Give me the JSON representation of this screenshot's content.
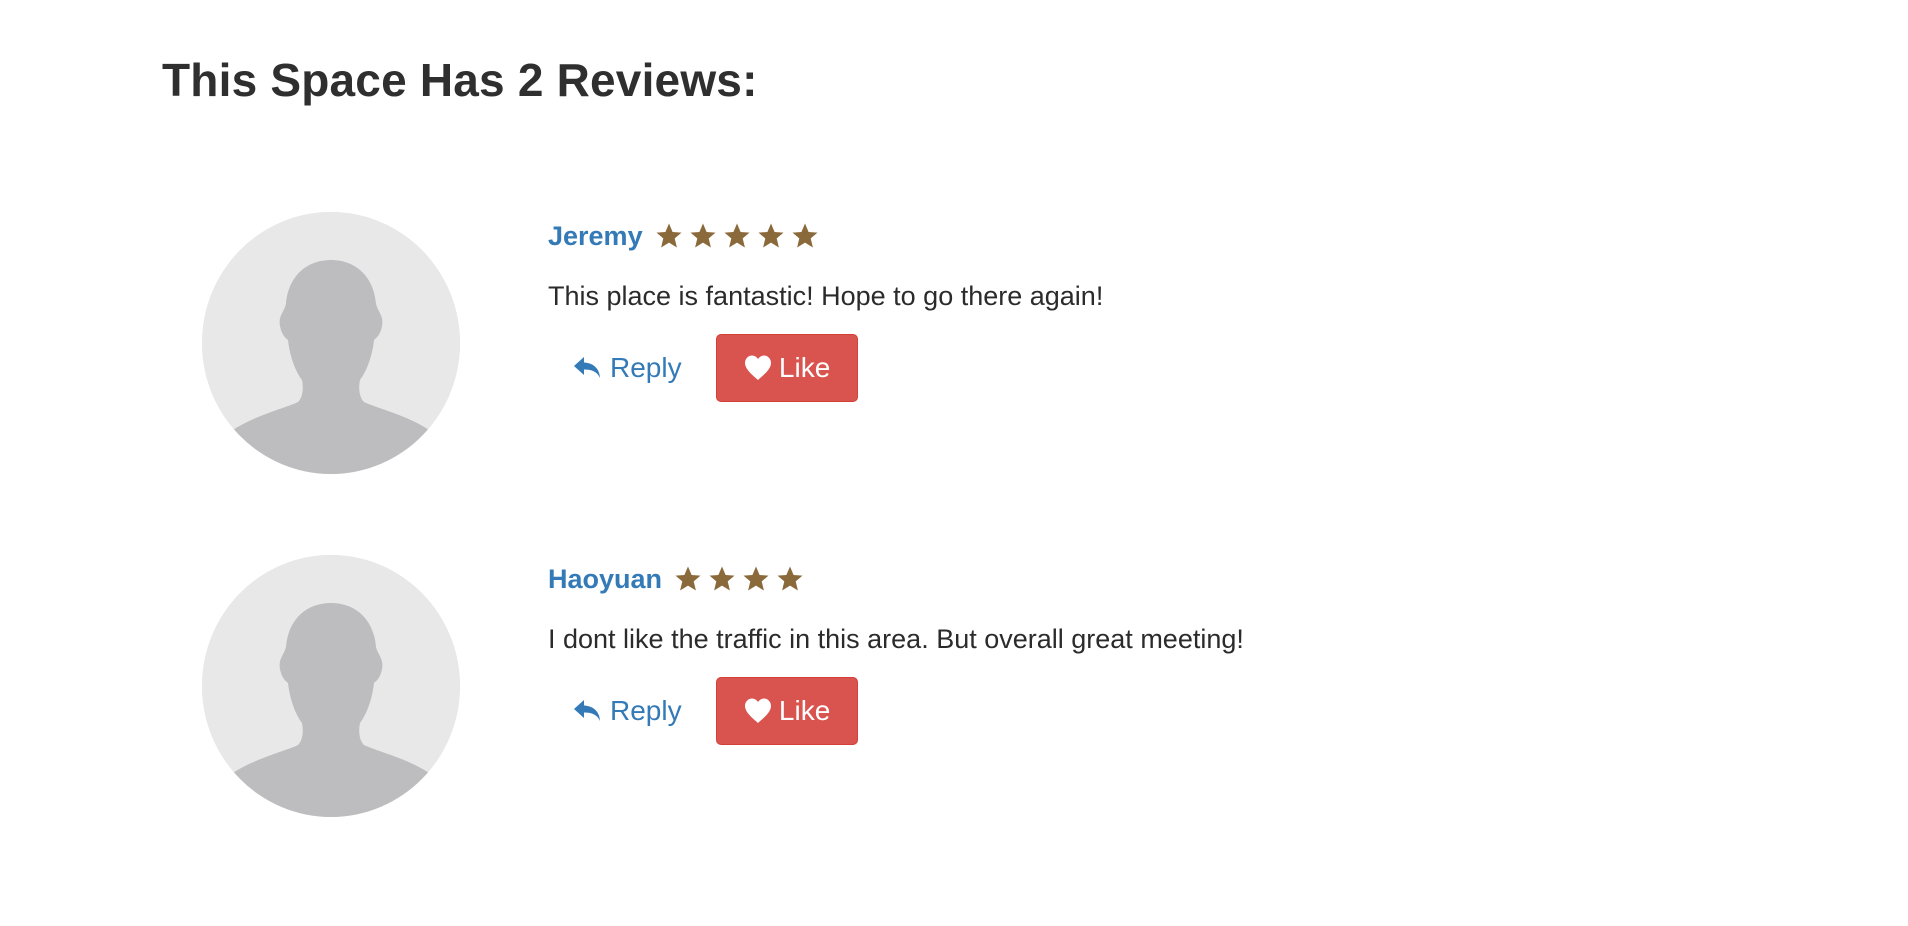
{
  "page": {
    "title": "This Space Has 2 Reviews:"
  },
  "colors": {
    "link_blue": "#337ab7",
    "star_brown": "#8a6a3a",
    "like_red": "#d9534f",
    "avatar_bg": "#e8e8e9",
    "avatar_silhouette": "#bdbdbf"
  },
  "reviews": [
    {
      "name": "Jeremy",
      "rating": 5,
      "text": "This place is fantastic! Hope to go there again!",
      "reply_label": "Reply",
      "like_label": "Like",
      "avatar_icon": "default-user-avatar",
      "reply_icon": "reply-arrow-icon",
      "like_icon": "heart-icon",
      "star_icon": "star-icon"
    },
    {
      "name": "Haoyuan",
      "rating": 4,
      "text": "I dont like the traffic in this area. But overall great meeting!",
      "reply_label": "Reply",
      "like_label": "Like",
      "avatar_icon": "default-user-avatar",
      "reply_icon": "reply-arrow-icon",
      "like_icon": "heart-icon",
      "star_icon": "star-icon"
    }
  ]
}
